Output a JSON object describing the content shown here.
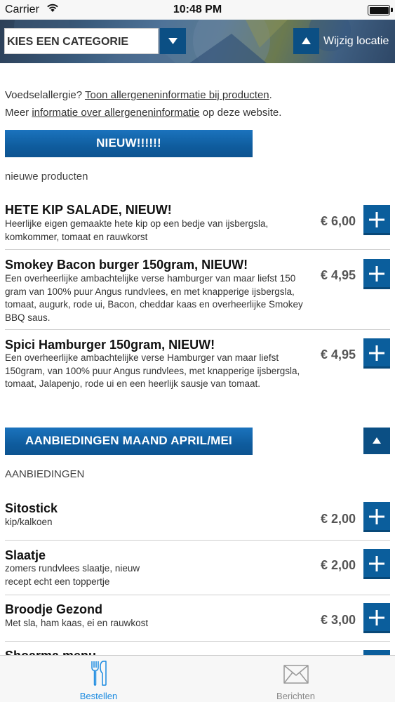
{
  "status_bar": {
    "carrier": "Carrier",
    "time": "10:48 PM"
  },
  "header": {
    "category_placeholder": "KIES EEN CATEGORIE",
    "location_label": "Wijzig locatie"
  },
  "allergy": {
    "line1_prefix": "Voedselallergie? ",
    "line1_link": "Toon allergeneninformatie bij producten",
    "line1_suffix": ".",
    "line2_prefix": "Meer ",
    "line2_link": "informatie over allergeneninformatie",
    "line2_suffix": " op deze website."
  },
  "sections": [
    {
      "title": "NIEUW!!!!!!",
      "subtitle": "nieuwe producten",
      "products": [
        {
          "name": "HETE KIP SALADE, NIEUW!",
          "description": "Heerlijke eigen gemaakte hete kip op een bedje van ijsbergsla, komkommer, tomaat en rauwkorst",
          "price": "€ 6,00"
        },
        {
          "name": "Smokey Bacon burger 150gram, NIEUW!",
          "description": "Een overheerlijke ambachtelijke verse hamburger van maar liefst 150 gram van 100% puur Angus rundvlees, en met knapperige ijsbergsla, tomaat, augurk, rode ui, Bacon, cheddar kaas en overheerlijke Smokey BBQ saus.",
          "price": "€ 4,95"
        },
        {
          "name": "Spici Hamburger 150gram, NIEUW!",
          "description": "Een overheerlijke ambachtelijke verse Hamburger van maar liefst 150gram, van 100% puur Angus rundvlees, met knapperige ijsbergsla, tomaat, Jalapenjo, rode ui en een heerlijk sausje van tomaat.",
          "price": "€ 4,95"
        }
      ]
    },
    {
      "title": "AANBIEDINGEN MAAND APRIL/MEI",
      "subtitle": "AANBIEDINGEN",
      "products": [
        {
          "name": "Sitostick",
          "description": "kip/kalkoen",
          "price": "€ 2,00"
        },
        {
          "name": "Slaatje",
          "description": "zomers rundvlees slaatje, nieuw recept echt een toppertje",
          "price": "€ 2,00"
        },
        {
          "name": "Broodje Gezond",
          "description": "Met sla, ham kaas, ei en rauwkost",
          "price": "€ 3,00"
        },
        {
          "name": "Shoarma menu",
          "description": "",
          "price": ""
        }
      ]
    }
  ],
  "tabs": [
    {
      "label": "Bestellen",
      "icon": "fork-knife-icon",
      "active": true
    },
    {
      "label": "Berichten",
      "icon": "envelope-icon",
      "active": false
    }
  ],
  "colors": {
    "accent_blue": "#0b5e9c",
    "tab_active": "#1a8ae0"
  }
}
